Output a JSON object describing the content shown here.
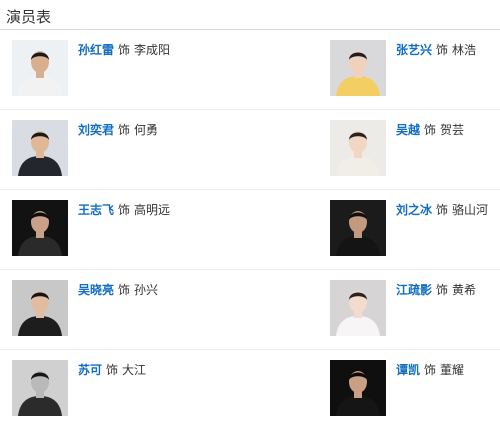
{
  "section_title": "演员表",
  "as_label": "饰",
  "cast": [
    {
      "actor": "孙红雷",
      "role": "李成阳",
      "photo_bg": "#eef1f3",
      "skin": "#d9b08f",
      "cloth": "#f2f2f2",
      "hair": "#1a1a1a"
    },
    {
      "actor": "张艺兴",
      "role": "林浩",
      "photo_bg": "#d9d9db",
      "skin": "#f0d2bc",
      "cloth": "#f3cf63",
      "hair": "#1e1e1e"
    },
    {
      "actor": "刘奕君",
      "role": "何勇",
      "photo_bg": "#d9dde3",
      "skin": "#e0b898",
      "cloth": "#23262c",
      "hair": "#1a1a1a"
    },
    {
      "actor": "吴越",
      "role": "贺芸",
      "photo_bg": "#ecebe8",
      "skin": "#f1d6c3",
      "cloth": "#f1eee8",
      "hair": "#2a211c"
    },
    {
      "actor": "王志飞",
      "role": "高明远",
      "photo_bg": "#121212",
      "skin": "#caa088",
      "cloth": "#2a2a2a",
      "hair": "#0d0d0d"
    },
    {
      "actor": "刘之冰",
      "role": "骆山河",
      "photo_bg": "#1b1b1b",
      "skin": "#c39a7e",
      "cloth": "#141414",
      "hair": "#0f0f0f"
    },
    {
      "actor": "吴晓亮",
      "role": "孙兴",
      "photo_bg": "#c8c8c8",
      "skin": "#e2bca0",
      "cloth": "#1d1d1d",
      "hair": "#151515"
    },
    {
      "actor": "江疏影",
      "role": "黄希",
      "photo_bg": "#d7d4d6",
      "skin": "#f3dccd",
      "cloth": "#f7f5f6",
      "hair": "#2b2220"
    },
    {
      "actor": "苏可",
      "role": "大江",
      "photo_bg": "#d0d0d0",
      "skin": "#b9b9b9",
      "cloth": "#2b2b2b",
      "hair": "#161616"
    },
    {
      "actor": "谭凯",
      "role": "董耀",
      "photo_bg": "#0f0f0f",
      "skin": "#c9a085",
      "cloth": "#151515",
      "hair": "#0b0b0b"
    }
  ]
}
